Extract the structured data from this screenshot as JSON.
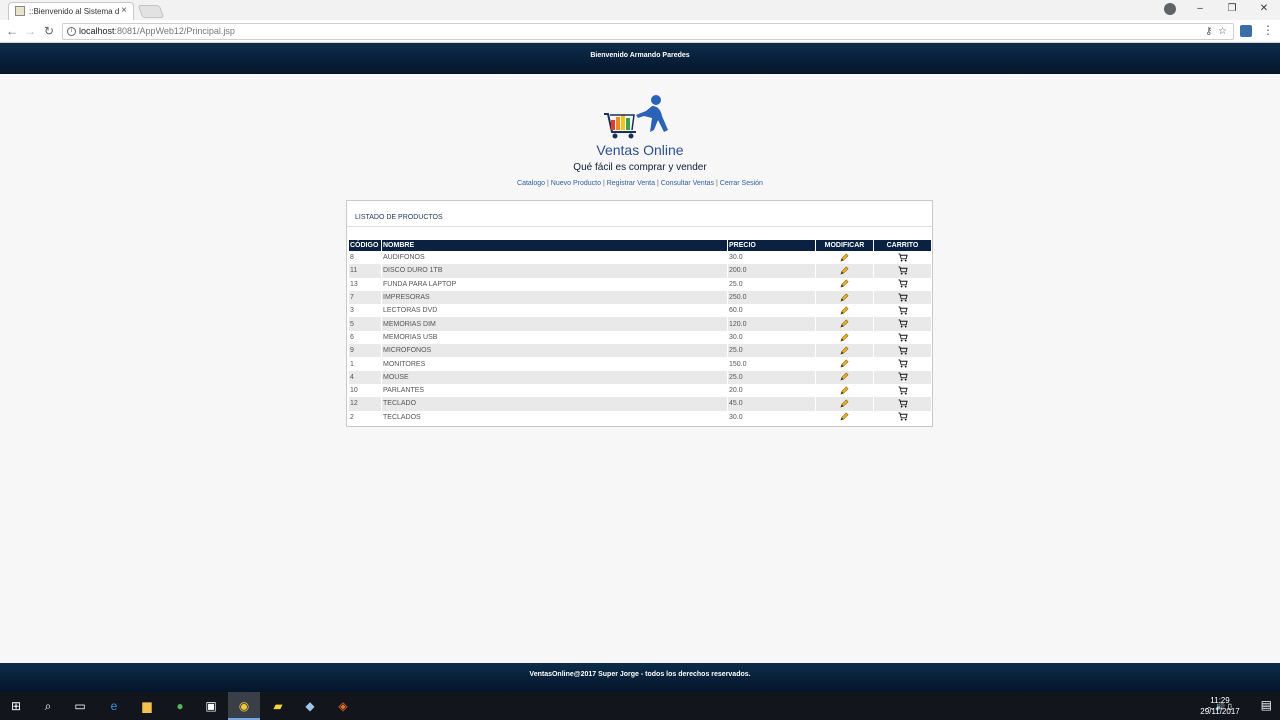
{
  "browser": {
    "tab_title": "::Bienvenido al Sistema d",
    "tab_close": "×",
    "url_host": "localhost",
    "url_rest": ":8081/AppWeb12/Principal.jsp",
    "window_controls": [
      "–",
      "❐",
      "✕"
    ]
  },
  "header": {
    "welcome": "Bienvenido Armando Paredes"
  },
  "logo": {
    "title": "Ventas Online",
    "tagline": "Qué fácil es comprar y vender"
  },
  "nav": {
    "links": [
      "Catalogo",
      "Nuevo Producto",
      "Registrar Venta",
      "Consultar Ventas",
      "Cerrar Sesión"
    ],
    "separator": "|"
  },
  "panel": {
    "title": "LISTADO DE PRODUCTOS",
    "columns": [
      "CÓDIGO",
      "NOMBRE",
      "PRECIO",
      "MODIFICAR",
      "CARRITO"
    ],
    "rows": [
      {
        "codigo": "8",
        "nombre": "AUDIFONOS",
        "precio": "30.0"
      },
      {
        "codigo": "11",
        "nombre": "DISCO DURO 1TB",
        "precio": "200.0"
      },
      {
        "codigo": "13",
        "nombre": "FUNDA PARA LAPTOP",
        "precio": "25.0"
      },
      {
        "codigo": "7",
        "nombre": "IMPRESORAS",
        "precio": "250.0"
      },
      {
        "codigo": "3",
        "nombre": "LECTORAS DVD",
        "precio": "60.0"
      },
      {
        "codigo": "5",
        "nombre": "MEMORIAS DIM",
        "precio": "120.0"
      },
      {
        "codigo": "6",
        "nombre": "MEMORIAS USB",
        "precio": "30.0"
      },
      {
        "codigo": "9",
        "nombre": "MICROFONOS",
        "precio": "25.0"
      },
      {
        "codigo": "1",
        "nombre": "MONITORES",
        "precio": "150.0"
      },
      {
        "codigo": "4",
        "nombre": "MOUSE",
        "precio": "25.0"
      },
      {
        "codigo": "10",
        "nombre": "PARLANTES",
        "precio": "20.0"
      },
      {
        "codigo": "12",
        "nombre": "TECLADO",
        "precio": "45.0"
      },
      {
        "codigo": "2",
        "nombre": "TECLADOS",
        "precio": "30.0"
      }
    ]
  },
  "footer": {
    "text": "VentasOnline@2017 Super Jorge - todos los derechos reservados."
  },
  "taskbar": {
    "time": "11:29",
    "date": "29/11/2017"
  },
  "colors": {
    "band": "#0a2142",
    "link": "#2f5fa0",
    "row_alt": "#e9e9e9"
  }
}
